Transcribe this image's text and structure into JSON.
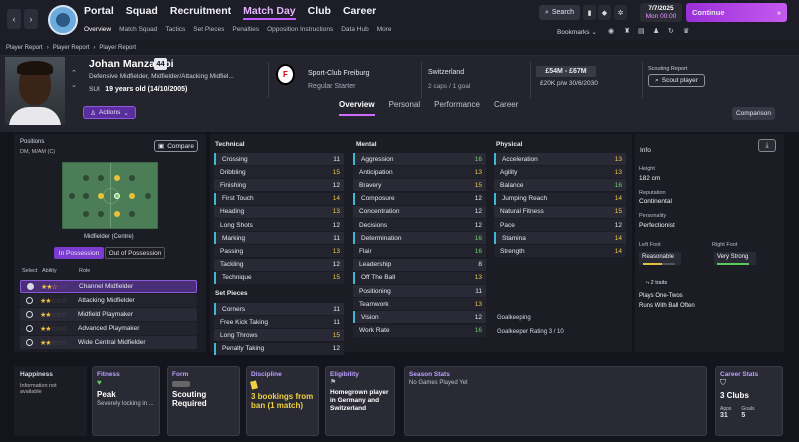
{
  "nav": {
    "menu": [
      "Portal",
      "Squad",
      "Recruitment",
      "Match Day",
      "Club",
      "Career"
    ],
    "active": "Match Day",
    "sub": [
      "Overview",
      "Match Squad",
      "Tactics",
      "Set Pieces",
      "Penalties",
      "Opposition Instructions",
      "Data Hub",
      "More"
    ],
    "search": "Search",
    "date": "7/7/2025",
    "day": "Mon 00:00",
    "continue": "Continue",
    "bookmarks": "Bookmarks"
  },
  "breadcrumb": [
    "Player Report",
    "Player Report",
    "Player Report"
  ],
  "player": {
    "name": "Johan Manzambi",
    "number": "44",
    "positions": "Defensive Midfielder, Midfielder/Attacking Midfiel...",
    "nat_code": "SUI",
    "age": "19 years old (14/10/2005)",
    "actions": "Actions",
    "club": "Sport-Club Freiburg",
    "status": "Regular Starter",
    "nation": "Switzerland",
    "caps": "2 caps / 1 goal",
    "value": "£54M - £67M",
    "wage": "£20K p/w 30/6/2030",
    "scout_label": "Scouting Report",
    "scout_btn": "Scout player"
  },
  "tabs": [
    "Overview",
    "Personal",
    "Performance",
    "Career"
  ],
  "comparison": "Comparison",
  "positions_panel": {
    "title": "Positions",
    "list": "DM, M/AM (C)",
    "compare": "Compare",
    "caption": "Midfielder (Centre)",
    "in_poss": "In Possession",
    "out_poss": "Out of Possession",
    "hdr_select": "Select",
    "hdr_ability": "Ability",
    "hdr_role": "Role",
    "roles": [
      {
        "name": "Channel Midfielder",
        "stars": "★★☆",
        "rest": "☆☆"
      },
      {
        "name": "Attacking Midfielder",
        "stars": "★★",
        "rest": "☆☆☆"
      },
      {
        "name": "Midfield Playmaker",
        "stars": "★★",
        "rest": "☆☆☆"
      },
      {
        "name": "Advanced Playmaker",
        "stars": "★★",
        "rest": "☆☆☆"
      },
      {
        "name": "Wide Central Midfielder",
        "stars": "★★",
        "rest": "☆☆☆"
      }
    ]
  },
  "technical": {
    "title": "Technical",
    "items": [
      [
        "Crossing",
        "11"
      ],
      [
        "Dribbling",
        "15"
      ],
      [
        "Finishing",
        "12"
      ],
      [
        "First Touch",
        "14"
      ],
      [
        "Heading",
        "13"
      ],
      [
        "Long Shots",
        "12"
      ],
      [
        "Marking",
        "11"
      ],
      [
        "Passing",
        "13"
      ],
      [
        "Tackling",
        "12"
      ],
      [
        "Technique",
        "15"
      ]
    ]
  },
  "setpieces": {
    "title": "Set Pieces",
    "items": [
      [
        "Corners",
        "11"
      ],
      [
        "Free Kick Taking",
        "11"
      ],
      [
        "Long Throws",
        "15"
      ],
      [
        "Penalty Taking",
        "12"
      ]
    ]
  },
  "mental": {
    "title": "Mental",
    "items": [
      [
        "Aggression",
        "16"
      ],
      [
        "Anticipation",
        "13"
      ],
      [
        "Bravery",
        "15"
      ],
      [
        "Composure",
        "12"
      ],
      [
        "Concentration",
        "12"
      ],
      [
        "Decisions",
        "12"
      ],
      [
        "Determination",
        "16"
      ],
      [
        "Flair",
        "16"
      ],
      [
        "Leadership",
        "8"
      ],
      [
        "Off The Ball",
        "13"
      ],
      [
        "Positioning",
        "11"
      ],
      [
        "Teamwork",
        "13"
      ],
      [
        "Vision",
        "12"
      ],
      [
        "Work Rate",
        "16"
      ]
    ]
  },
  "physical": {
    "title": "Physical",
    "items": [
      [
        "Acceleration",
        "13"
      ],
      [
        "Agility",
        "13"
      ],
      [
        "Balance",
        "16"
      ],
      [
        "Jumping Reach",
        "14"
      ],
      [
        "Natural Fitness",
        "15"
      ],
      [
        "Pace",
        "12"
      ],
      [
        "Stamina",
        "14"
      ],
      [
        "Strength",
        "14"
      ]
    ]
  },
  "goalkeeping": {
    "title": "Goalkeeping",
    "rating": "Goalkeeper Rating  3 / 10"
  },
  "info": {
    "title": "Info",
    "height_l": "Height",
    "height": "182 cm",
    "rep_l": "Reputation",
    "rep": "Continental",
    "pers_l": "Personality",
    "pers": "Perfectionist",
    "lf_l": "Left Foot",
    "lf": "Reasonable",
    "rf_l": "Right Foot",
    "rf": "Very Strong",
    "traits_l": "2 traits",
    "trait1": "Plays One-Twos",
    "trait2": "Runs With Ball Often"
  },
  "cards": {
    "happiness": "Happiness",
    "happy_txt": "Information not available",
    "fitness": "Fitness",
    "fitness_v": "Peak",
    "fitness_s": "Severely locking in ...",
    "form": "Form",
    "form_v": "Scouting Required",
    "disc": "Discipline",
    "disc_v": "3 bookings from ban (1 match)",
    "elig": "Eligibility",
    "elig_v": "Homegrown player in Germany and Switzerland",
    "season": "Season Stats",
    "season_v": "No Games Played Yet",
    "career": "Career Stats",
    "career_v": "3 Clubs",
    "apps_l": "Apps",
    "apps": "31",
    "goals_l": "Goals",
    "goals": "5"
  }
}
